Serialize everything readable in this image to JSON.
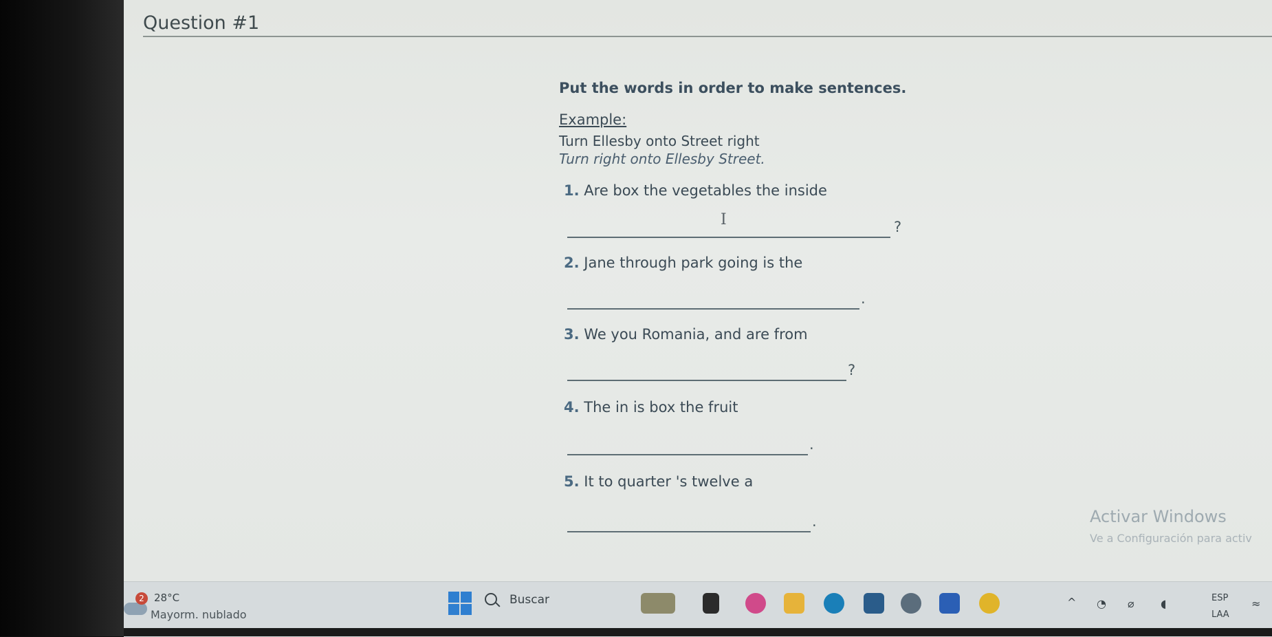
{
  "worksheet": {
    "title": "Question #1",
    "instructions": "Put the words in order to make sentences.",
    "example_label": "Example:",
    "example_words": "Turn Ellesby onto Street right",
    "example_answer": "Turn right onto Ellesby Street.",
    "items": [
      {
        "number": "1.",
        "words": "Are box the vegetables the inside",
        "end": "?"
      },
      {
        "number": "2.",
        "words": "Jane through park going is the",
        "end": "."
      },
      {
        "number": "3.",
        "words": "We you Romania, and are from",
        "end": "?"
      },
      {
        "number": "4.",
        "words": "The in is box the fruit",
        "end": "."
      },
      {
        "number": "5.",
        "words": "It to quarter 's twelve a",
        "end": "."
      }
    ]
  },
  "watermark": {
    "title": "Activar Windows",
    "subtitle": "Ve a Configuración para activ"
  },
  "taskbar": {
    "weather_badge": "2",
    "temperature": "28°C",
    "condition": "Mayorm. nublado",
    "search_label": "Buscar",
    "language_line1": "ESP",
    "language_line2": "LAA",
    "accent_color": "#2f7fd0"
  }
}
